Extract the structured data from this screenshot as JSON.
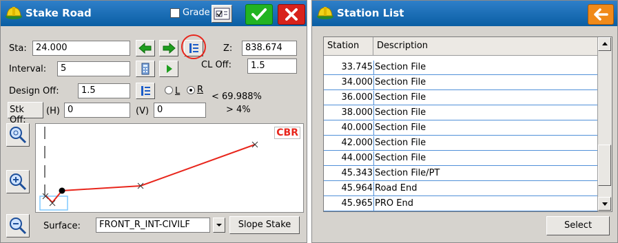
{
  "stake_road": {
    "title": "Stake Road",
    "grade_label": "Grade",
    "sta_label": "Sta:",
    "sta_value": "24.000",
    "z_label": "Z:",
    "z_value": "838.674",
    "interval_label": "Interval:",
    "interval_value": "5",
    "cl_off_label": "CL Off:",
    "cl_off_value": "1.5",
    "design_off_label": "Design Off:",
    "design_off_value": "1.5",
    "side_l": "L",
    "side_r": "R",
    "side_selected": "R",
    "slope_pct_1": "< 69.988%",
    "slope_pct_2": "> 4%",
    "stk_off_label": "Stk Off:",
    "h_label": "(H)",
    "h_value": "0",
    "v_label": "(V)",
    "v_value": "0",
    "cbr_label": "CBR",
    "surface_label": "Surface:",
    "surface_value": "FRONT_R_INT-CIVILF",
    "slope_stake_label": "Slope Stake"
  },
  "station_list": {
    "title": "Station List",
    "columns": [
      "Station",
      "Description"
    ],
    "rows": [
      [
        "33.745",
        "Section File"
      ],
      [
        "34.000",
        "Section File"
      ],
      [
        "36.000",
        "Section File"
      ],
      [
        "38.000",
        "Section File"
      ],
      [
        "40.000",
        "Section File"
      ],
      [
        "42.000",
        "Section File"
      ],
      [
        "44.000",
        "Section File"
      ],
      [
        "45.343",
        "Section File/PT"
      ],
      [
        "45.964",
        "Road End"
      ],
      [
        "45.965",
        "PRO End"
      ]
    ],
    "select_label": "Select"
  },
  "colors": {
    "title_bar": "#0a5ea3",
    "ok_green": "#22b422",
    "cancel_red": "#d8231c",
    "back_orange": "#f08a1a",
    "profile_line": "#e8261c",
    "row_border": "#4f8fd8"
  },
  "icons": {
    "app": "hardhat-icon",
    "ok": "checkmark-icon",
    "cancel": "close-icon",
    "back": "arrow-left-icon",
    "prev": "arrow-left-green-icon",
    "next": "arrow-right-green-icon",
    "list": "station-list-icon",
    "calc": "calculator-icon",
    "play": "play-icon",
    "zoom_extents": "zoom-extents-icon",
    "zoom_in": "zoom-in-icon",
    "zoom_out": "zoom-out-icon"
  }
}
